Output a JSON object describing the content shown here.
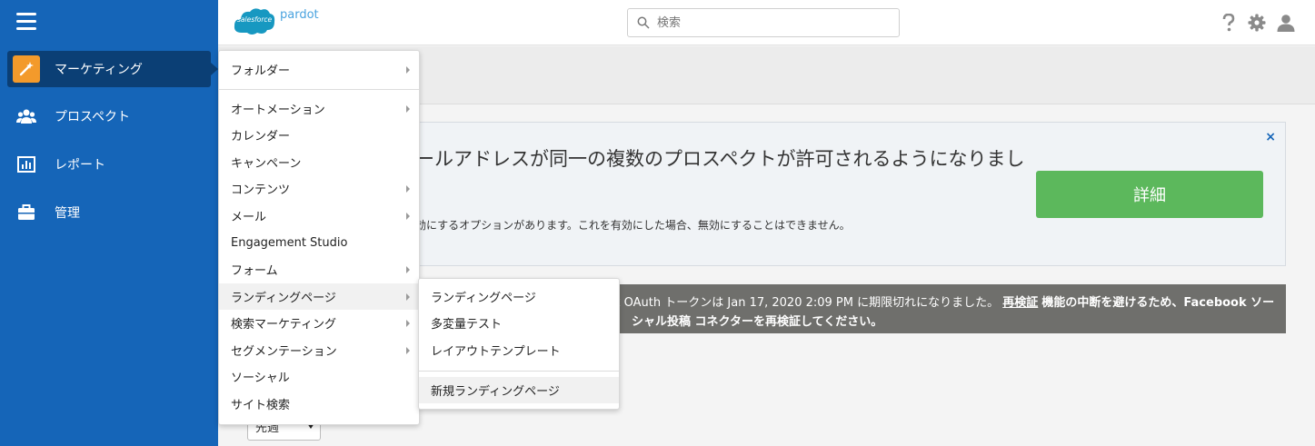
{
  "sidebar": {
    "items": [
      {
        "label": "マーケティング",
        "icon": "magic-wand-icon"
      },
      {
        "label": "プロスペクト",
        "icon": "users-icon"
      },
      {
        "label": "レポート",
        "icon": "bar-chart-icon"
      },
      {
        "label": "管理",
        "icon": "briefcase-icon"
      }
    ]
  },
  "header": {
    "logo_text": "salesforce",
    "logo_sub": "pardot",
    "search_placeholder": "検索"
  },
  "notice": {
    "title": "ールアドレスが同一の複数のプロスペクトが許可されるようになりまし",
    "body": "効にするオプションがあります。これを有効にした場合、無効にすることはできません。",
    "button": "詳細",
    "close": "×"
  },
  "warning": {
    "line1_pre": "k OAuth トークンは Jan 17, 2020 2:09 PM に期限切れになりました。",
    "link": "再検証",
    "line1_post": "機能の中断を避けるため、Facebook ソー",
    "line2": "シャル投稿 コネクターを再検証してください。"
  },
  "period_select": "先週",
  "menu": {
    "items": [
      {
        "label": "フォルダー"
      },
      {
        "label": "オートメーション"
      },
      {
        "label": "カレンダー"
      },
      {
        "label": "キャンペーン"
      },
      {
        "label": "コンテンツ"
      },
      {
        "label": "メール"
      },
      {
        "label": "Engagement Studio"
      },
      {
        "label": "フォーム"
      },
      {
        "label": "ランディングページ"
      },
      {
        "label": "検索マーケティング"
      },
      {
        "label": "セグメンテーション"
      },
      {
        "label": "ソーシャル"
      },
      {
        "label": "サイト検索"
      }
    ]
  },
  "submenu": {
    "items": [
      {
        "label": "ランディングページ"
      },
      {
        "label": "多変量テスト"
      },
      {
        "label": "レイアウトテンプレート"
      },
      {
        "label": "新規ランディングページ"
      }
    ]
  },
  "colors": {
    "sidebar": "#1565b8",
    "sidebar_active": "#0b3f75",
    "accent_orange": "#f39a2b",
    "detail_button": "#5cb85c",
    "warning_bg": "#6f6f6c"
  }
}
